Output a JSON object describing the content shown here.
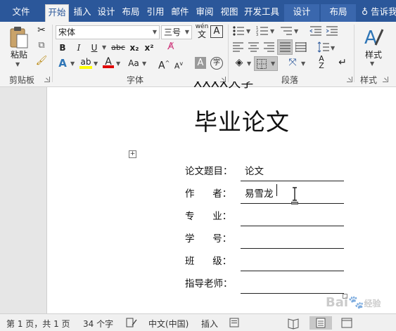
{
  "tabs": [
    {
      "label": "文件",
      "active": false,
      "context": false
    },
    {
      "label": "开始",
      "active": true,
      "context": false
    },
    {
      "label": "插入",
      "active": false,
      "context": false
    },
    {
      "label": "设计",
      "active": false,
      "context": false
    },
    {
      "label": "布局",
      "active": false,
      "context": false
    },
    {
      "label": "引用",
      "active": false,
      "context": false
    },
    {
      "label": "邮件",
      "active": false,
      "context": false
    },
    {
      "label": "审阅",
      "active": false,
      "context": false
    },
    {
      "label": "视图",
      "active": false,
      "context": false
    },
    {
      "label": "开发工具",
      "active": false,
      "context": false
    },
    {
      "label": "设计",
      "active": false,
      "context": true
    },
    {
      "label": "布局",
      "active": false,
      "context": true
    }
  ],
  "tell_me": "告诉我",
  "ribbon": {
    "clipboard": {
      "paste_label": "粘贴",
      "group_label": "剪贴板"
    },
    "font": {
      "font_name": "宋体",
      "font_size": "三号",
      "wen_label": "wén",
      "bold": "B",
      "italic": "I",
      "underline": "U",
      "strike": "abc",
      "subscript": "x₂",
      "superscript": "x²",
      "case_label": "Aa",
      "grow": "A",
      "shrink": "A",
      "char_shade": "A",
      "enclose": "字",
      "group_label": "字体"
    },
    "paragraph": {
      "group_label": "段落"
    },
    "styles": {
      "label": "样式",
      "group_label": "样式"
    },
    "colors": {
      "accent": "#2b579a",
      "highlight": "#ffff00",
      "font_color": "#e00000"
    }
  },
  "document": {
    "partial_heading": "XXXX大学",
    "title": "毕业论文",
    "fields": [
      {
        "label": "论文题目：",
        "value": "论文"
      },
      {
        "label": "作      者：",
        "value": "易雪龙"
      },
      {
        "label": "专      业：",
        "value": ""
      },
      {
        "label": "学      号：",
        "value": ""
      },
      {
        "label": "班      级：",
        "value": ""
      },
      {
        "label": "指导老师：",
        "value": ""
      }
    ]
  },
  "status": {
    "page": "第 1 页，共 1 页",
    "words": "34 个字",
    "language": "中文(中国)",
    "mode": "插入"
  },
  "watermark": {
    "brand": "Bai",
    "suffix": "经验"
  }
}
